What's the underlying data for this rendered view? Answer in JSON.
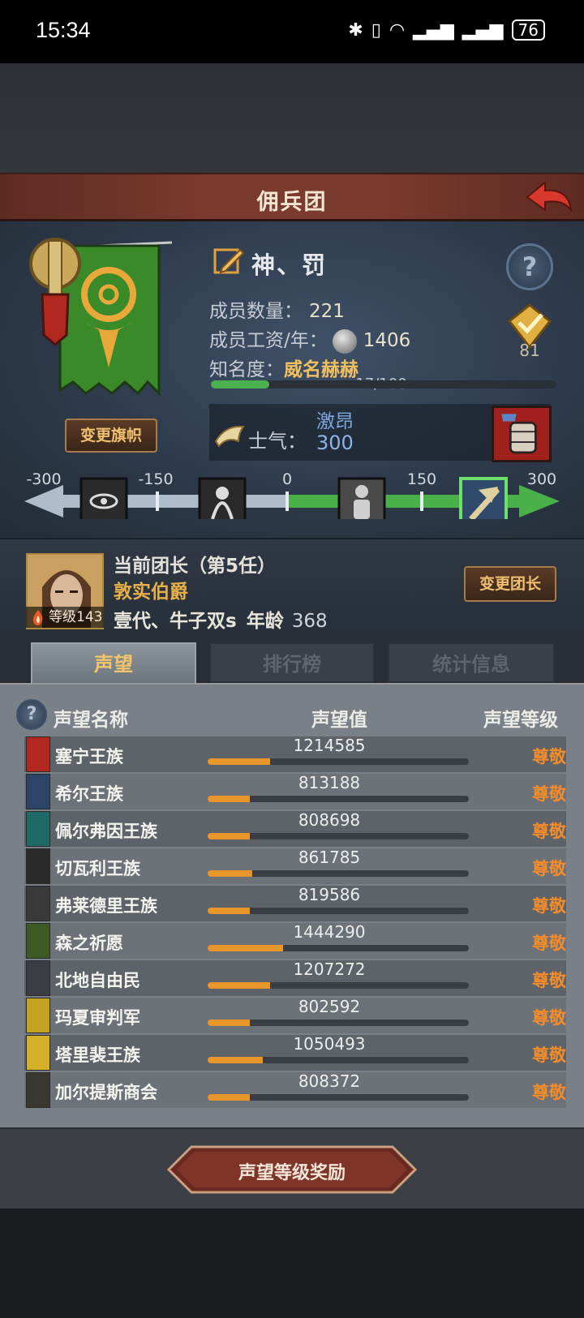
{
  "status_bar": {
    "time": "15:34",
    "battery": "76"
  },
  "window": {
    "title": "佣兵团"
  },
  "guild": {
    "name": "神、罚",
    "change_flag_label": "变更旗帜",
    "rank_number": "81",
    "members_label": "成员数量：",
    "members_value": "221",
    "wage_label": "成员工资/年：",
    "wage_value": "1406",
    "fame_label": "知名度：",
    "fame_value": "威名赫赫",
    "fame_progress_text": "17/100",
    "fame_progress": 0.17,
    "morale_label": "士气：",
    "morale_state": "激昂",
    "morale_value": "300",
    "morale_ticks": [
      "-300",
      "-150",
      "0",
      "150",
      "300"
    ]
  },
  "leader": {
    "title": "当前团长（第5任）",
    "name": "敦实伯爵",
    "level_text": "等级143",
    "player": "壹代、牛子双s",
    "age_label": "年龄",
    "age_value": "368",
    "change_button": "变更团长"
  },
  "tabs": [
    {
      "label": "声望",
      "active": true
    },
    {
      "label": "排行榜",
      "active": false
    },
    {
      "label": "统计信息",
      "active": false
    }
  ],
  "reputation": {
    "headers": {
      "name": "声望名称",
      "value": "声望值",
      "level": "声望等级"
    },
    "rows": [
      {
        "name": "塞宁王族",
        "value": "1214585",
        "level": "尊敬",
        "progress": 0.24,
        "color": "#b3281e"
      },
      {
        "name": "希尔王族",
        "value": "813188",
        "level": "尊敬",
        "progress": 0.16,
        "color": "#2c4468"
      },
      {
        "name": "佩尔弗因王族",
        "value": "808698",
        "level": "尊敬",
        "progress": 0.16,
        "color": "#1e6a66"
      },
      {
        "name": "切瓦利王族",
        "value": "861785",
        "level": "尊敬",
        "progress": 0.17,
        "color": "#2a2a2a"
      },
      {
        "name": "弗莱德里王族",
        "value": "819586",
        "level": "尊敬",
        "progress": 0.16,
        "color": "#3a3a3a"
      },
      {
        "name": "森之祈愿",
        "value": "1444290",
        "level": "尊敬",
        "progress": 0.29,
        "color": "#3c5a22"
      },
      {
        "name": "北地自由民",
        "value": "1207272",
        "level": "尊敬",
        "progress": 0.24,
        "color": "#3a3d44"
      },
      {
        "name": "玛夏审判军",
        "value": "802592",
        "level": "尊敬",
        "progress": 0.16,
        "color": "#c6a222"
      },
      {
        "name": "塔里裴王族",
        "value": "1050493",
        "level": "尊敬",
        "progress": 0.21,
        "color": "#d4b028"
      },
      {
        "name": "加尔提斯商会",
        "value": "808372",
        "level": "尊敬",
        "progress": 0.16,
        "color": "#3a3630"
      }
    ]
  },
  "reward_button": "声望等级奖励"
}
